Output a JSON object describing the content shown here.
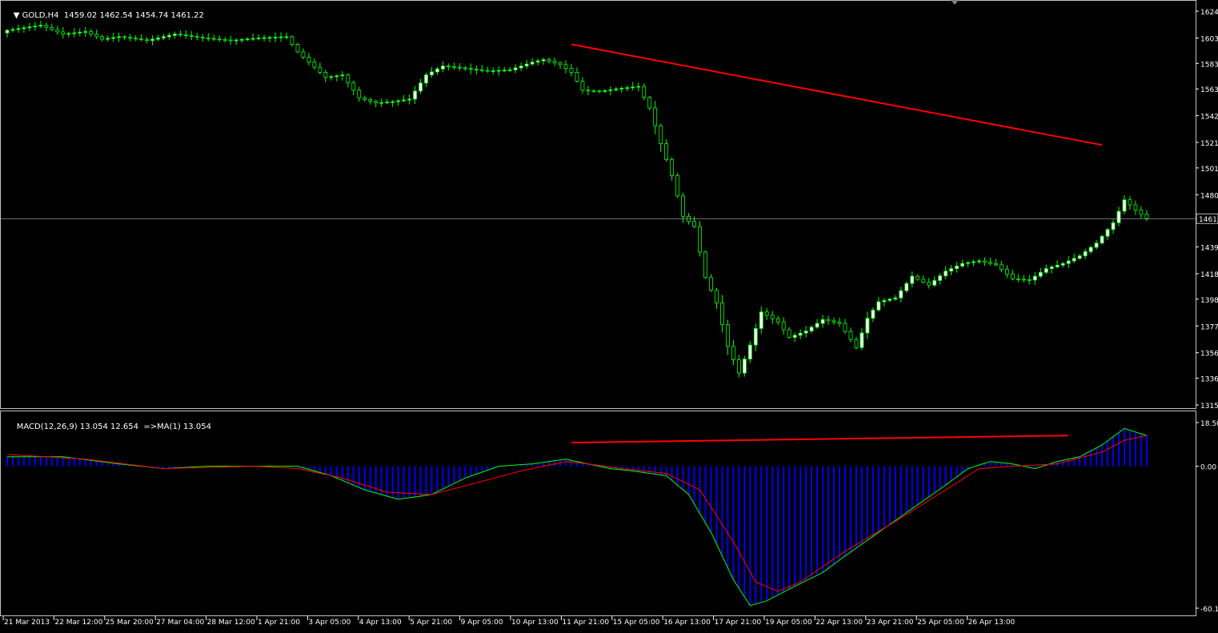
{
  "main_header": {
    "symbol_label": "GOLD,H4",
    "ohlc": "1459.02 1462.54 1454.74 1461.22"
  },
  "sub_header": {
    "indicator_label": "MACD(12,26,9) 13.054 12.654",
    "extra_label": "=>MA(1) 13.054"
  },
  "colors": {
    "background": "#000000",
    "grid_frame": "#c0c0c0",
    "candle_bull_fill": "#ffffff",
    "candle_bear_fill": "#000000",
    "candle_outline": "#00ff00",
    "trendline": "#ff0000",
    "macd_hist": "#0000ff",
    "macd_line": "#00ff00",
    "signal_line": "#ff0000",
    "current_price_line": "#c0c0c0"
  },
  "chart_data": [
    {
      "type": "candlestick",
      "title": "GOLD,H4",
      "price_axis_ticks": [
        "1624.",
        "1603.",
        "1583.",
        "1563.",
        "1542.",
        "1521.",
        "1501.",
        "1480.",
        "1461.",
        "1439.",
        "1418.",
        "1398.",
        "1377.",
        "1356.",
        "1336.",
        "1315."
      ],
      "price_axis_values": [
        1624,
        1603,
        1583,
        1563,
        1542,
        1521,
        1501,
        1480,
        1439,
        1418,
        1398,
        1377,
        1356,
        1336,
        1315
      ],
      "ylim": [
        1315,
        1624
      ],
      "current_price_label": "1461.",
      "current_price": 1461.22,
      "x_ticks": [
        "21 Mar 2013",
        "22 Mar 12:00",
        "25 Mar 20:00",
        "27 Mar 04:00",
        "28 Mar 12:00",
        "1 Apr 21:00",
        "3 Apr 05:00",
        "4 Apr 13:00",
        "5 Apr 21:00",
        "9 Apr 05:00",
        "10 Apr 13:00",
        "11 Apr 21:00",
        "15 Apr 05:00",
        "16 Apr 13:00",
        "17 Apr 21:00",
        "19 Apr 05:00",
        "22 Apr 13:00",
        "23 Apr 21:00",
        "25 Apr 05:00",
        "26 Apr 13:00"
      ],
      "close_path": [
        [
          0,
          1609
        ],
        [
          6,
          1613
        ],
        [
          10,
          1606
        ],
        [
          14,
          1608
        ],
        [
          17,
          1602
        ],
        [
          20,
          1604
        ],
        [
          25,
          1601
        ],
        [
          30,
          1606
        ],
        [
          35,
          1603
        ],
        [
          40,
          1601
        ],
        [
          45,
          1603
        ],
        [
          50,
          1604
        ],
        [
          52,
          1592
        ],
        [
          55,
          1580
        ],
        [
          57,
          1572
        ],
        [
          60,
          1574
        ],
        [
          63,
          1556
        ],
        [
          66,
          1552
        ],
        [
          69,
          1553
        ],
        [
          72,
          1555
        ],
        [
          75,
          1574
        ],
        [
          78,
          1581
        ],
        [
          82,
          1579
        ],
        [
          86,
          1577
        ],
        [
          90,
          1578
        ],
        [
          94,
          1584
        ],
        [
          96,
          1586
        ],
        [
          99,
          1582
        ],
        [
          101,
          1576
        ],
        [
          103,
          1562
        ],
        [
          106,
          1561
        ],
        [
          109,
          1563
        ],
        [
          113,
          1565
        ],
        [
          115,
          1548
        ],
        [
          117,
          1520
        ],
        [
          119,
          1495
        ],
        [
          121,
          1463
        ],
        [
          123,
          1455
        ],
        [
          125,
          1415
        ],
        [
          127,
          1395
        ],
        [
          129,
          1361
        ],
        [
          131,
          1340
        ],
        [
          133,
          1362
        ],
        [
          135,
          1388
        ],
        [
          138,
          1380
        ],
        [
          140,
          1368
        ],
        [
          143,
          1373
        ],
        [
          146,
          1382
        ],
        [
          149,
          1379
        ],
        [
          152,
          1360
        ],
        [
          154,
          1383
        ],
        [
          156,
          1396
        ],
        [
          159,
          1399
        ],
        [
          162,
          1416
        ],
        [
          165,
          1409
        ],
        [
          168,
          1420
        ],
        [
          171,
          1426
        ],
        [
          174,
          1428
        ],
        [
          177,
          1425
        ],
        [
          180,
          1414
        ],
        [
          183,
          1413
        ],
        [
          186,
          1422
        ],
        [
          189,
          1426
        ],
        [
          192,
          1432
        ],
        [
          195,
          1442
        ],
        [
          198,
          1458
        ],
        [
          200,
          1476
        ],
        [
          202,
          1468
        ],
        [
          204,
          1461
        ]
      ],
      "annotations": [
        {
          "type": "trendline",
          "from": [
            101,
            1598
          ],
          "to": [
            196,
            1519
          ]
        }
      ]
    },
    {
      "type": "bar",
      "title": "MACD(12,26,9) 13.054 12.654",
      "price_axis_ticks": [
        "18.502",
        "0.00",
        "-60.11"
      ],
      "ylim": [
        -60.11,
        18.502
      ],
      "series": [
        {
          "name": "MACD",
          "style": "histogram",
          "values": [
            [
              0,
              4
            ],
            [
              10,
              4
            ],
            [
              20,
              1
            ],
            [
              28,
              -1
            ],
            [
              36,
              0
            ],
            [
              44,
              0
            ],
            [
              52,
              0
            ],
            [
              58,
              -4
            ],
            [
              64,
              -10
            ],
            [
              70,
              -14
            ],
            [
              76,
              -12
            ],
            [
              82,
              -5
            ],
            [
              88,
              0
            ],
            [
              94,
              1
            ],
            [
              100,
              3
            ],
            [
              104,
              1
            ],
            [
              108,
              -1
            ],
            [
              112,
              -2
            ],
            [
              118,
              -4
            ],
            [
              122,
              -12
            ],
            [
              126,
              -28
            ],
            [
              130,
              -48
            ],
            [
              133,
              -59
            ],
            [
              136,
              -57
            ],
            [
              140,
              -52
            ],
            [
              146,
              -45
            ],
            [
              150,
              -38
            ],
            [
              156,
              -28
            ],
            [
              162,
              -18
            ],
            [
              168,
              -8
            ],
            [
              172,
              -1
            ],
            [
              176,
              2
            ],
            [
              180,
              1
            ],
            [
              184,
              -1
            ],
            [
              188,
              2
            ],
            [
              192,
              4
            ],
            [
              196,
              9
            ],
            [
              200,
              16
            ],
            [
              204,
              13
            ]
          ]
        },
        {
          "name": "MA",
          "style": "line",
          "values": [
            [
              0,
              5
            ],
            [
              14,
              3
            ],
            [
              28,
              -1
            ],
            [
              44,
              0
            ],
            [
              52,
              -1
            ],
            [
              60,
              -5
            ],
            [
              68,
              -11
            ],
            [
              76,
              -12
            ],
            [
              84,
              -7
            ],
            [
              92,
              -2
            ],
            [
              100,
              2
            ],
            [
              104,
              1
            ],
            [
              110,
              -1
            ],
            [
              118,
              -3
            ],
            [
              124,
              -10
            ],
            [
              130,
              -32
            ],
            [
              134,
              -49
            ],
            [
              138,
              -53
            ],
            [
              142,
              -49
            ],
            [
              150,
              -36
            ],
            [
              160,
              -22
            ],
            [
              168,
              -10
            ],
            [
              174,
              -1
            ],
            [
              180,
              0
            ],
            [
              188,
              1
            ],
            [
              196,
              6
            ],
            [
              200,
              11
            ],
            [
              204,
              13
            ]
          ]
        }
      ],
      "annotations": [
        {
          "type": "trendline",
          "from": [
            101,
            10
          ],
          "to": [
            190,
            13
          ]
        }
      ]
    }
  ]
}
